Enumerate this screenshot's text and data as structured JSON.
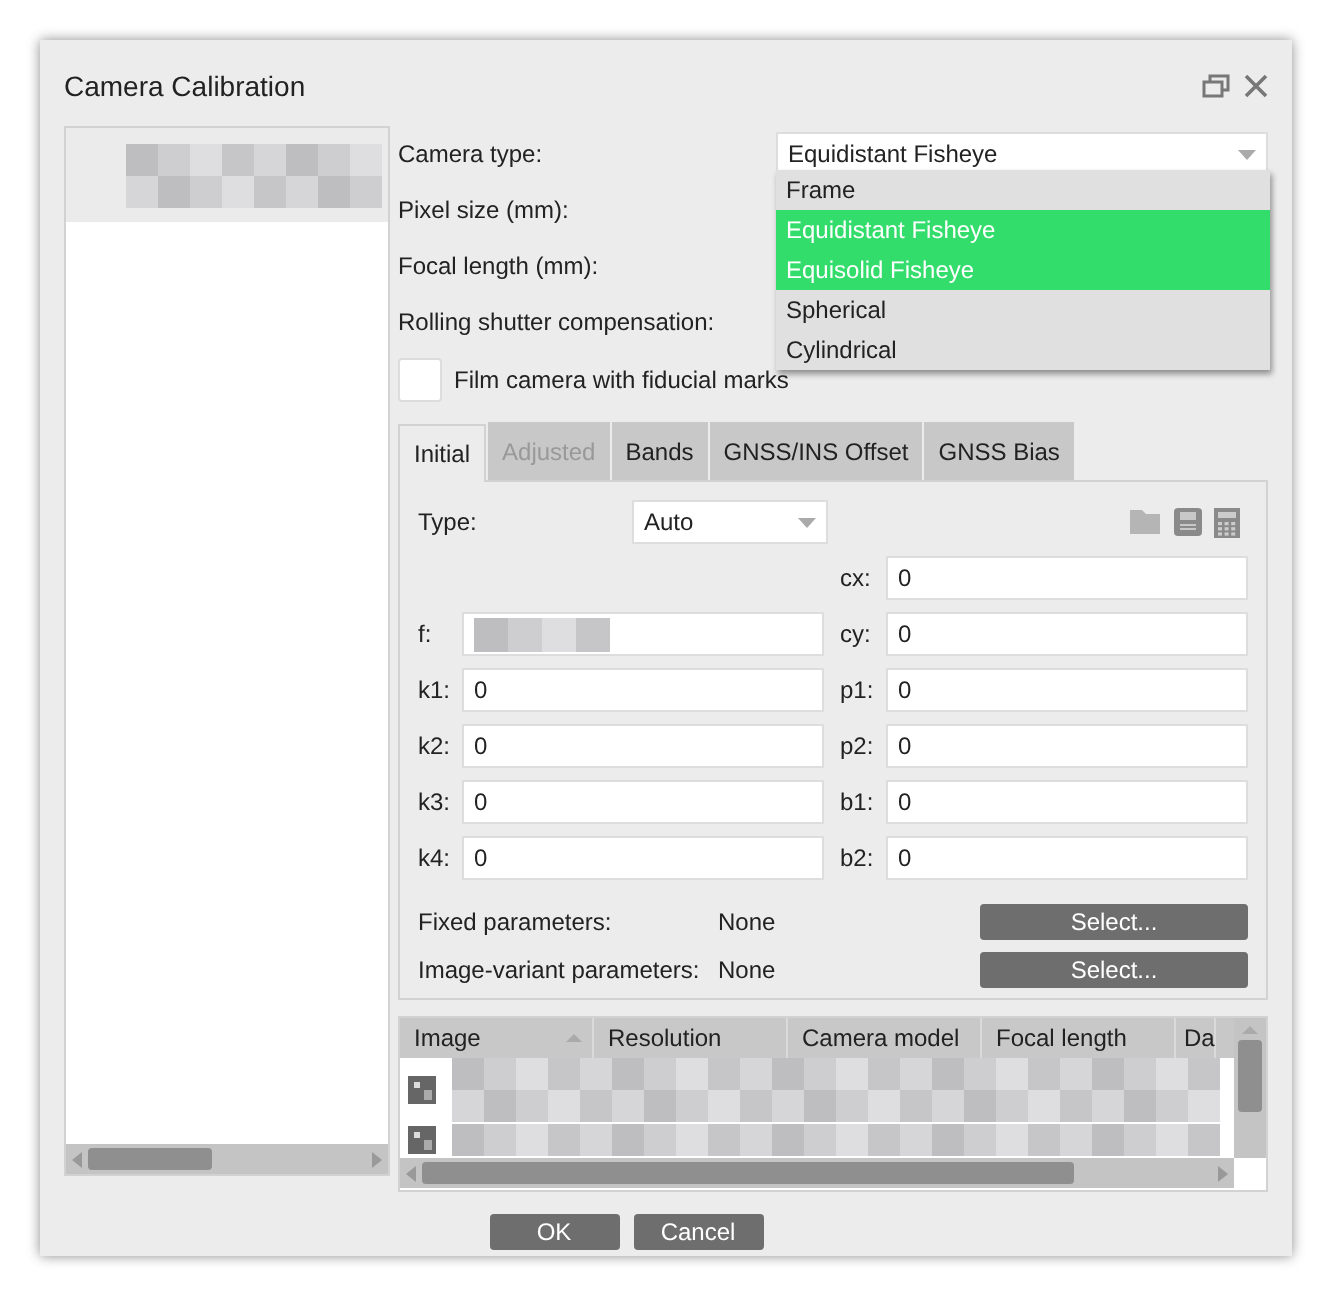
{
  "window": {
    "title": "Camera Calibration"
  },
  "camera_type": {
    "label": "Camera type:",
    "value": "Equidistant Fisheye",
    "options": [
      {
        "label": "Frame",
        "highlighted": false
      },
      {
        "label": "Equidistant Fisheye",
        "highlighted": true
      },
      {
        "label": "Equisolid Fisheye",
        "highlighted": true
      },
      {
        "label": "Spherical",
        "highlighted": false
      },
      {
        "label": "Cylindrical",
        "highlighted": false
      }
    ]
  },
  "form_labels": [
    "Pixel size (mm):",
    "Focal length (mm):",
    "Rolling shutter compensation:"
  ],
  "film_camera": {
    "label": "Film camera with fiducial marks",
    "checked": false
  },
  "tabs": [
    {
      "label": "Initial",
      "selected": true,
      "disabled": false
    },
    {
      "label": "Adjusted",
      "selected": false,
      "disabled": true
    },
    {
      "label": "Bands",
      "selected": false,
      "disabled": false
    },
    {
      "label": "GNSS/INS Offset",
      "selected": false,
      "disabled": false
    },
    {
      "label": "GNSS Bias",
      "selected": false,
      "disabled": false
    }
  ],
  "type": {
    "label": "Type:",
    "value": "Auto"
  },
  "params": [
    {
      "right": {
        "label": "cx:",
        "value": "0"
      }
    },
    {
      "left": {
        "label": "f:",
        "redacted": true
      },
      "right": {
        "label": "cy:",
        "value": "0"
      }
    },
    {
      "left": {
        "label": "k1:",
        "value": "0"
      },
      "right": {
        "label": "p1:",
        "value": "0"
      }
    },
    {
      "left": {
        "label": "k2:",
        "value": "0"
      },
      "right": {
        "label": "p2:",
        "value": "0"
      }
    },
    {
      "left": {
        "label": "k3:",
        "value": "0"
      },
      "right": {
        "label": "b1:",
        "value": "0"
      }
    },
    {
      "left": {
        "label": "k4:",
        "value": "0"
      },
      "right": {
        "label": "b2:",
        "value": "0"
      }
    }
  ],
  "selections": [
    {
      "label": "Fixed parameters:",
      "value": "None",
      "button": "Select..."
    },
    {
      "label": "Image-variant parameters:",
      "value": "None",
      "button": "Select..."
    }
  ],
  "table": {
    "columns": [
      {
        "label": "Image",
        "sorted": true
      },
      {
        "label": "Resolution",
        "sorted": false
      },
      {
        "label": "Camera model",
        "sorted": false
      },
      {
        "label": "Focal length",
        "sorted": false
      },
      {
        "label": "Da",
        "sorted": false
      }
    ]
  },
  "buttons": [
    {
      "label": "OK"
    },
    {
      "label": "Cancel"
    }
  ]
}
